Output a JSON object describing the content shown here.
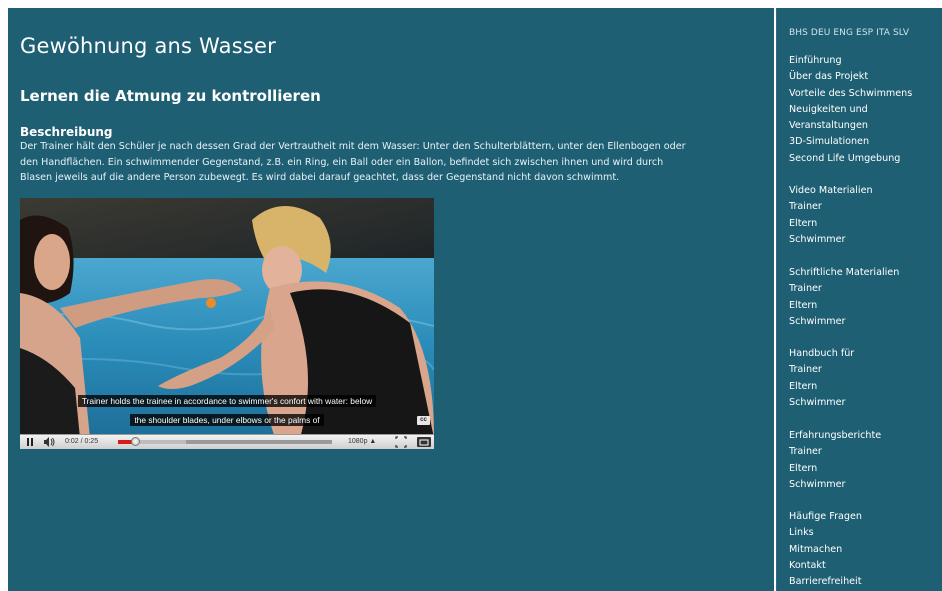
{
  "main": {
    "title": "Gewöhnung ans Wasser",
    "subtitle": "Lernen die Atmung zu kontrollieren",
    "section_heading": "Beschreibung",
    "description_lines": [
      "Der Trainer hält den Schüler je nach dessen Grad der Vertrautheit mit dem Wasser: Unter den Schulterblättern, unter den Ellenbogen oder",
      "den Handflächen. Ein schwimmender Gegenstand, z.B. ein Ring, ein Ball oder ein Ballon, befindet sich zwischen ihnen und wird durch",
      "Blasen jeweils auf die andere Person zubewegt. Es wird dabei darauf geachtet, dass der Gegenstand nicht davon schwimmt."
    ]
  },
  "video": {
    "caption_line1": "Trainer holds the trainee in accordance to swimmer's confort with water: below",
    "caption_line2": "the shoulder blades, under elbows or the palms of",
    "cc_label": "cc",
    "time": "0:02 / 0:25",
    "quality": "1080p",
    "played_fraction": 0.08,
    "loaded_fraction": 0.32,
    "icons": [
      "pause-icon",
      "volume-icon",
      "quality-up-arrow-icon",
      "fullscreen-icon",
      "popout-icon"
    ],
    "colors": {
      "progress": "#d61b1b",
      "water": "#2a8bb8"
    }
  },
  "sidebar": {
    "languages": "BHS DEU ENG ESP ITA SLV",
    "groups": [
      {
        "items": [
          "Einführung",
          "Über das Projekt",
          "Vorteile des Schwimmens",
          "Neuigkeiten und",
          "Veranstaltungen",
          "3D-Simulationen",
          "Second Life Umgebung"
        ]
      },
      {
        "items": [
          "Video Materialien",
          "Trainer",
          "Eltern",
          "Schwimmer"
        ]
      },
      {
        "items": [
          "Schriftliche Materialien",
          "Trainer",
          "Eltern",
          "Schwimmer"
        ]
      },
      {
        "items": [
          "Handbuch für",
          "Trainer",
          "Eltern",
          "Schwimmer"
        ]
      },
      {
        "items": [
          "Erfahrungsberichte",
          "Trainer",
          "Eltern",
          "Schwimmer"
        ]
      },
      {
        "items": [
          "Häufige Fragen",
          "Links",
          "Mitmachen",
          "Kontakt",
          "Barrierefreiheit"
        ]
      }
    ]
  },
  "colors": {
    "background": "#1f5f73",
    "text": "#ffffff"
  }
}
